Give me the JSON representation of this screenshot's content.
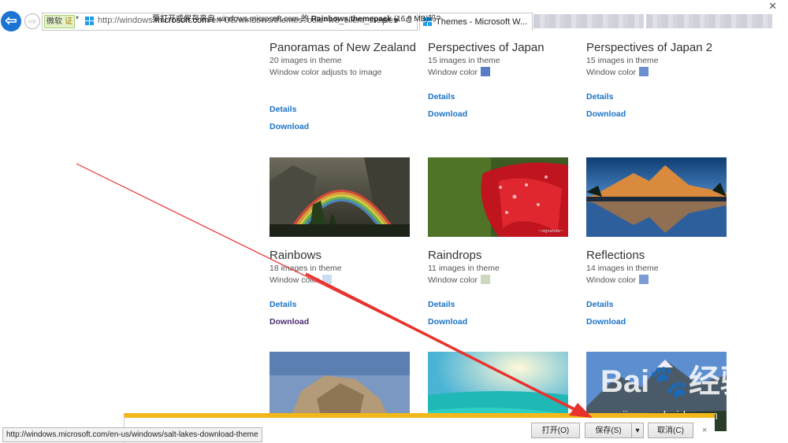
{
  "browser": {
    "back_icon": "back-arrow-icon",
    "forward_icon": "forward-arrow-icon",
    "cert_label": "微软",
    "cert_badge": "证",
    "url_prefix": "http://windows.",
    "url_domain": "microsoft.com",
    "url_suffix": "/en-US/windows/themes?ocid=w8_client_themes",
    "address_tools": "ρ ▾ C",
    "active_tab_title": "Themes - Microsoft W...",
    "close_glyph": "✕"
  },
  "themes": [
    {
      "name": "Panoramas of New Zealand",
      "count": "20 images in theme",
      "color_text": "Window color adjusts to image",
      "swatch": "",
      "details": "Details",
      "download": "Download"
    },
    {
      "name": "Perspectives of Japan",
      "count": "15 images in theme",
      "color_text": "Window color",
      "swatch": "#5a7cc7",
      "details": "Details",
      "download": "Download"
    },
    {
      "name": "Perspectives of Japan 2",
      "count": "15 images in theme",
      "color_text": "Window color",
      "swatch": "#6c8fd0",
      "details": "Details",
      "download": "Download"
    },
    {
      "name": "Rainbows",
      "count": "18 images in theme",
      "color_text": "Window color",
      "swatch": "#c9dcf5",
      "details": "Details",
      "download": "Download"
    },
    {
      "name": "Raindrops",
      "count": "11 images in theme",
      "color_text": "Window color",
      "swatch": "#ccd7c0",
      "details": "Details",
      "download": "Download"
    },
    {
      "name": "Reflections",
      "count": "14 images in theme",
      "color_text": "Window color",
      "swatch": "#7a9bd4",
      "details": "Details",
      "download": "Download"
    }
  ],
  "download_bar": {
    "prompt_pre": "要打开或保存来自 windows.microsoft.com 的 ",
    "file_name": "Rainbows.themepack",
    "prompt_post": " (16.9 MB)吗?",
    "open_label": "打开(O)",
    "save_label": "保存(S)",
    "save_dropdown": "▾",
    "cancel_label": "取消(C)",
    "close_glyph": "×"
  },
  "status_url": "http://windows.microsoft.com/en-us/windows/salt-lakes-download-theme",
  "watermark": {
    "main": "Bai🐾经验",
    "sub": "jingyan.baidu.com"
  },
  "colors": {
    "accent_blue": "#1a73c8",
    "download_bar_accent": "#f2b81b",
    "arrow_red": "#e8322d"
  }
}
